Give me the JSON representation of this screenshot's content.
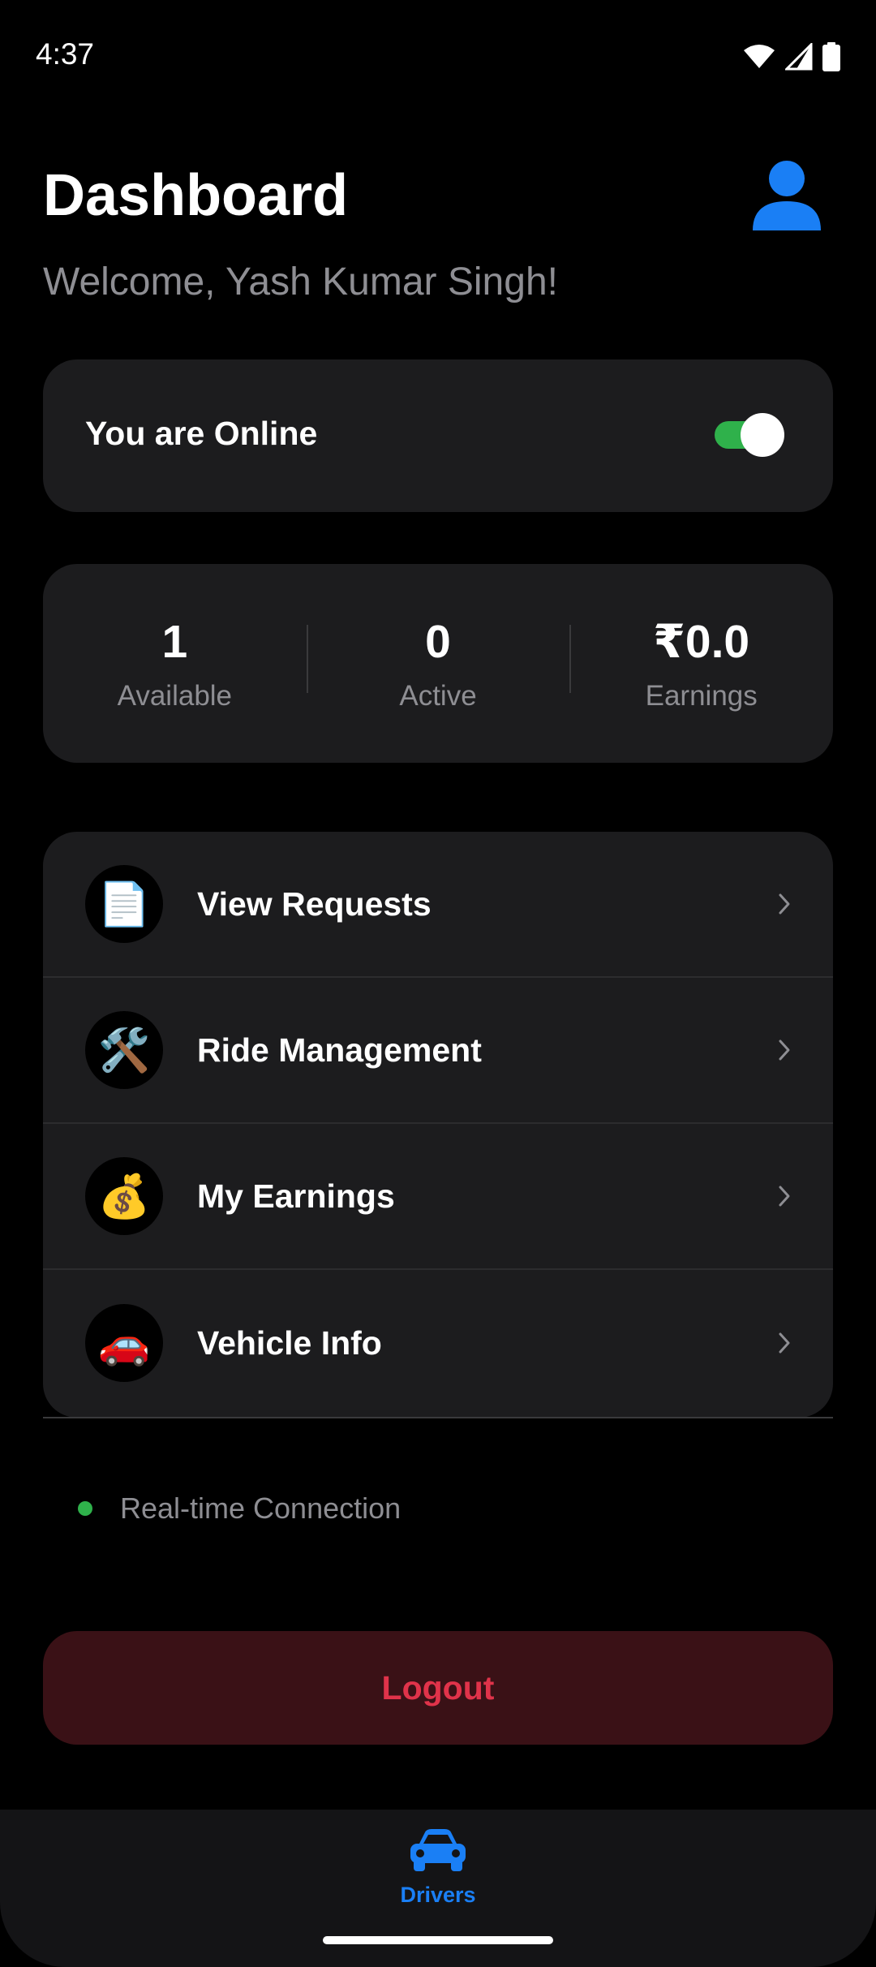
{
  "status_bar": {
    "time": "4:37",
    "icons": [
      "wifi-icon",
      "cell-signal-icon",
      "battery-icon"
    ]
  },
  "header": {
    "title": "Dashboard",
    "welcome": "Welcome, Yash Kumar Singh!",
    "profile_icon": "person-icon",
    "profile_emoji": "👤"
  },
  "online_status": {
    "label": "You are Online",
    "toggle_on": true
  },
  "stats": [
    {
      "value": "1",
      "label": "Available"
    },
    {
      "value": "0",
      "label": "Active"
    },
    {
      "value": "₹0.0",
      "label": "Earnings"
    }
  ],
  "menu": {
    "items": [
      {
        "label": "View Requests",
        "icon": "document-icon",
        "emoji": "📄"
      },
      {
        "label": "Ride Management",
        "icon": "tools-icon",
        "emoji": "🛠️"
      },
      {
        "label": "My Earnings",
        "icon": "money-bag-icon",
        "emoji": "💰"
      },
      {
        "label": "Vehicle Info",
        "icon": "car-icon",
        "emoji": "🚗"
      }
    ]
  },
  "connection": {
    "label": "Real-time Connection"
  },
  "logout": {
    "label": "Logout"
  },
  "bottom_nav": {
    "tabs": [
      {
        "label": "Drivers",
        "icon": "car-icon",
        "active": true
      }
    ]
  },
  "colors": {
    "background": "#000000",
    "card": "#1c1c1e",
    "muted_text": "#8e8e93",
    "accent_blue": "#1a7ff5",
    "online_green": "#2fb14b",
    "logout_red": "#e0334a",
    "logout_bg": "#3a1116"
  }
}
